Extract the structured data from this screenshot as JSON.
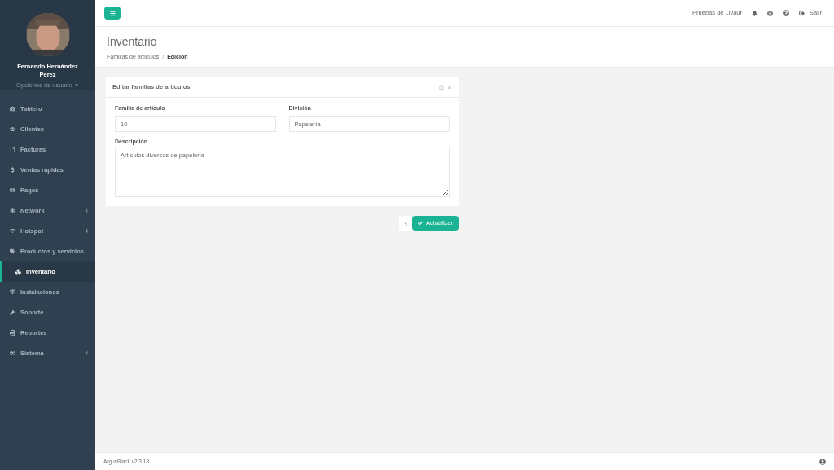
{
  "user": {
    "name": "Fernando Hernández Perez",
    "options": "Opciones de usuario"
  },
  "sidebar": {
    "items": [
      {
        "label": "Tablero",
        "expandable": false,
        "selected": false
      },
      {
        "label": "Clientes",
        "expandable": false,
        "selected": false
      },
      {
        "label": "Facturas",
        "expandable": false,
        "selected": false
      },
      {
        "label": "Ventas rápidas",
        "expandable": false,
        "selected": false
      },
      {
        "label": "Pagos",
        "expandable": false,
        "selected": false
      },
      {
        "label": "Network",
        "expandable": true,
        "selected": false
      },
      {
        "label": "Hotspot",
        "expandable": true,
        "selected": false
      },
      {
        "label": "Productos y servicios",
        "expandable": false,
        "selected": false
      },
      {
        "label": "Inventario",
        "expandable": false,
        "selected": true
      },
      {
        "label": "Instalaciones",
        "expandable": false,
        "selected": false
      },
      {
        "label": "Soporte",
        "expandable": false,
        "selected": false
      },
      {
        "label": "Reportes",
        "expandable": false,
        "selected": false
      },
      {
        "label": "Sistema",
        "expandable": true,
        "selected": false
      }
    ]
  },
  "topbar": {
    "account": "Pruebas de Livaur",
    "logout": "Salir"
  },
  "page": {
    "title": "Inventario",
    "breadcrumb": [
      "Familias de artículos",
      "Edición"
    ],
    "breadcrumb_separator": "/"
  },
  "panel": {
    "title": "Editar familias de artículos",
    "fields": [
      {
        "label": "Familia de artículo",
        "value": "10"
      },
      {
        "label": "División",
        "value": "Papelería"
      }
    ],
    "description": {
      "label": "Descripción",
      "value": "Artículos diversos de papelería"
    }
  },
  "actions": {
    "submit": "Actualizar"
  },
  "footer": {
    "version": "ArgusBlack v2.3.18"
  }
}
